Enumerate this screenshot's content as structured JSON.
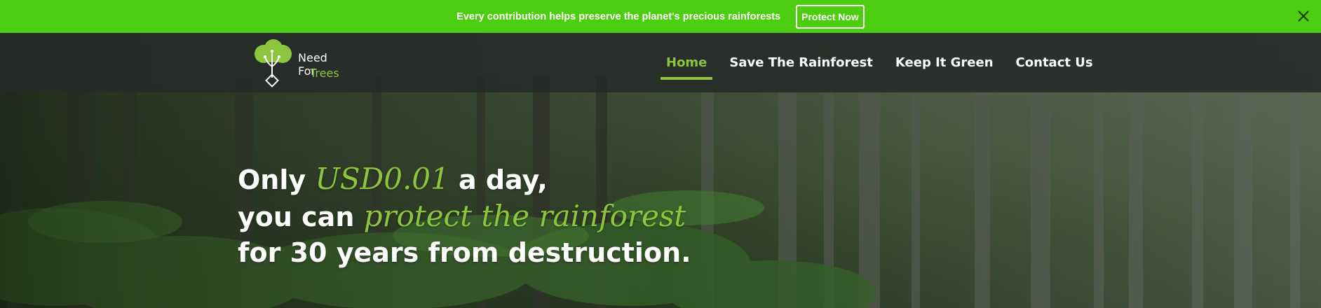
{
  "announcement": {
    "text": "Every contribution helps preserve the planet's precious rainforests",
    "button_label": "Protect Now",
    "bg_color": "#4ccd10"
  },
  "logo": {
    "line1": "Need For",
    "line2": "Trees"
  },
  "nav": {
    "items": [
      {
        "label": "Home",
        "active": true
      },
      {
        "label": "Save The Rainforest",
        "active": false
      },
      {
        "label": "Keep It Green",
        "active": false
      },
      {
        "label": "Contact Us",
        "active": false
      }
    ],
    "accent_color": "#8cc63f"
  },
  "hero": {
    "line1_pre": "Only ",
    "line1_em": "USD0.01",
    "line1_post": " a day,",
    "line2_pre": "you can ",
    "line2_em": "protect the rainforest",
    "line3": "for 30 years from destruction."
  },
  "icons": {
    "close": "close-icon",
    "logo": "tree-logo-icon"
  }
}
